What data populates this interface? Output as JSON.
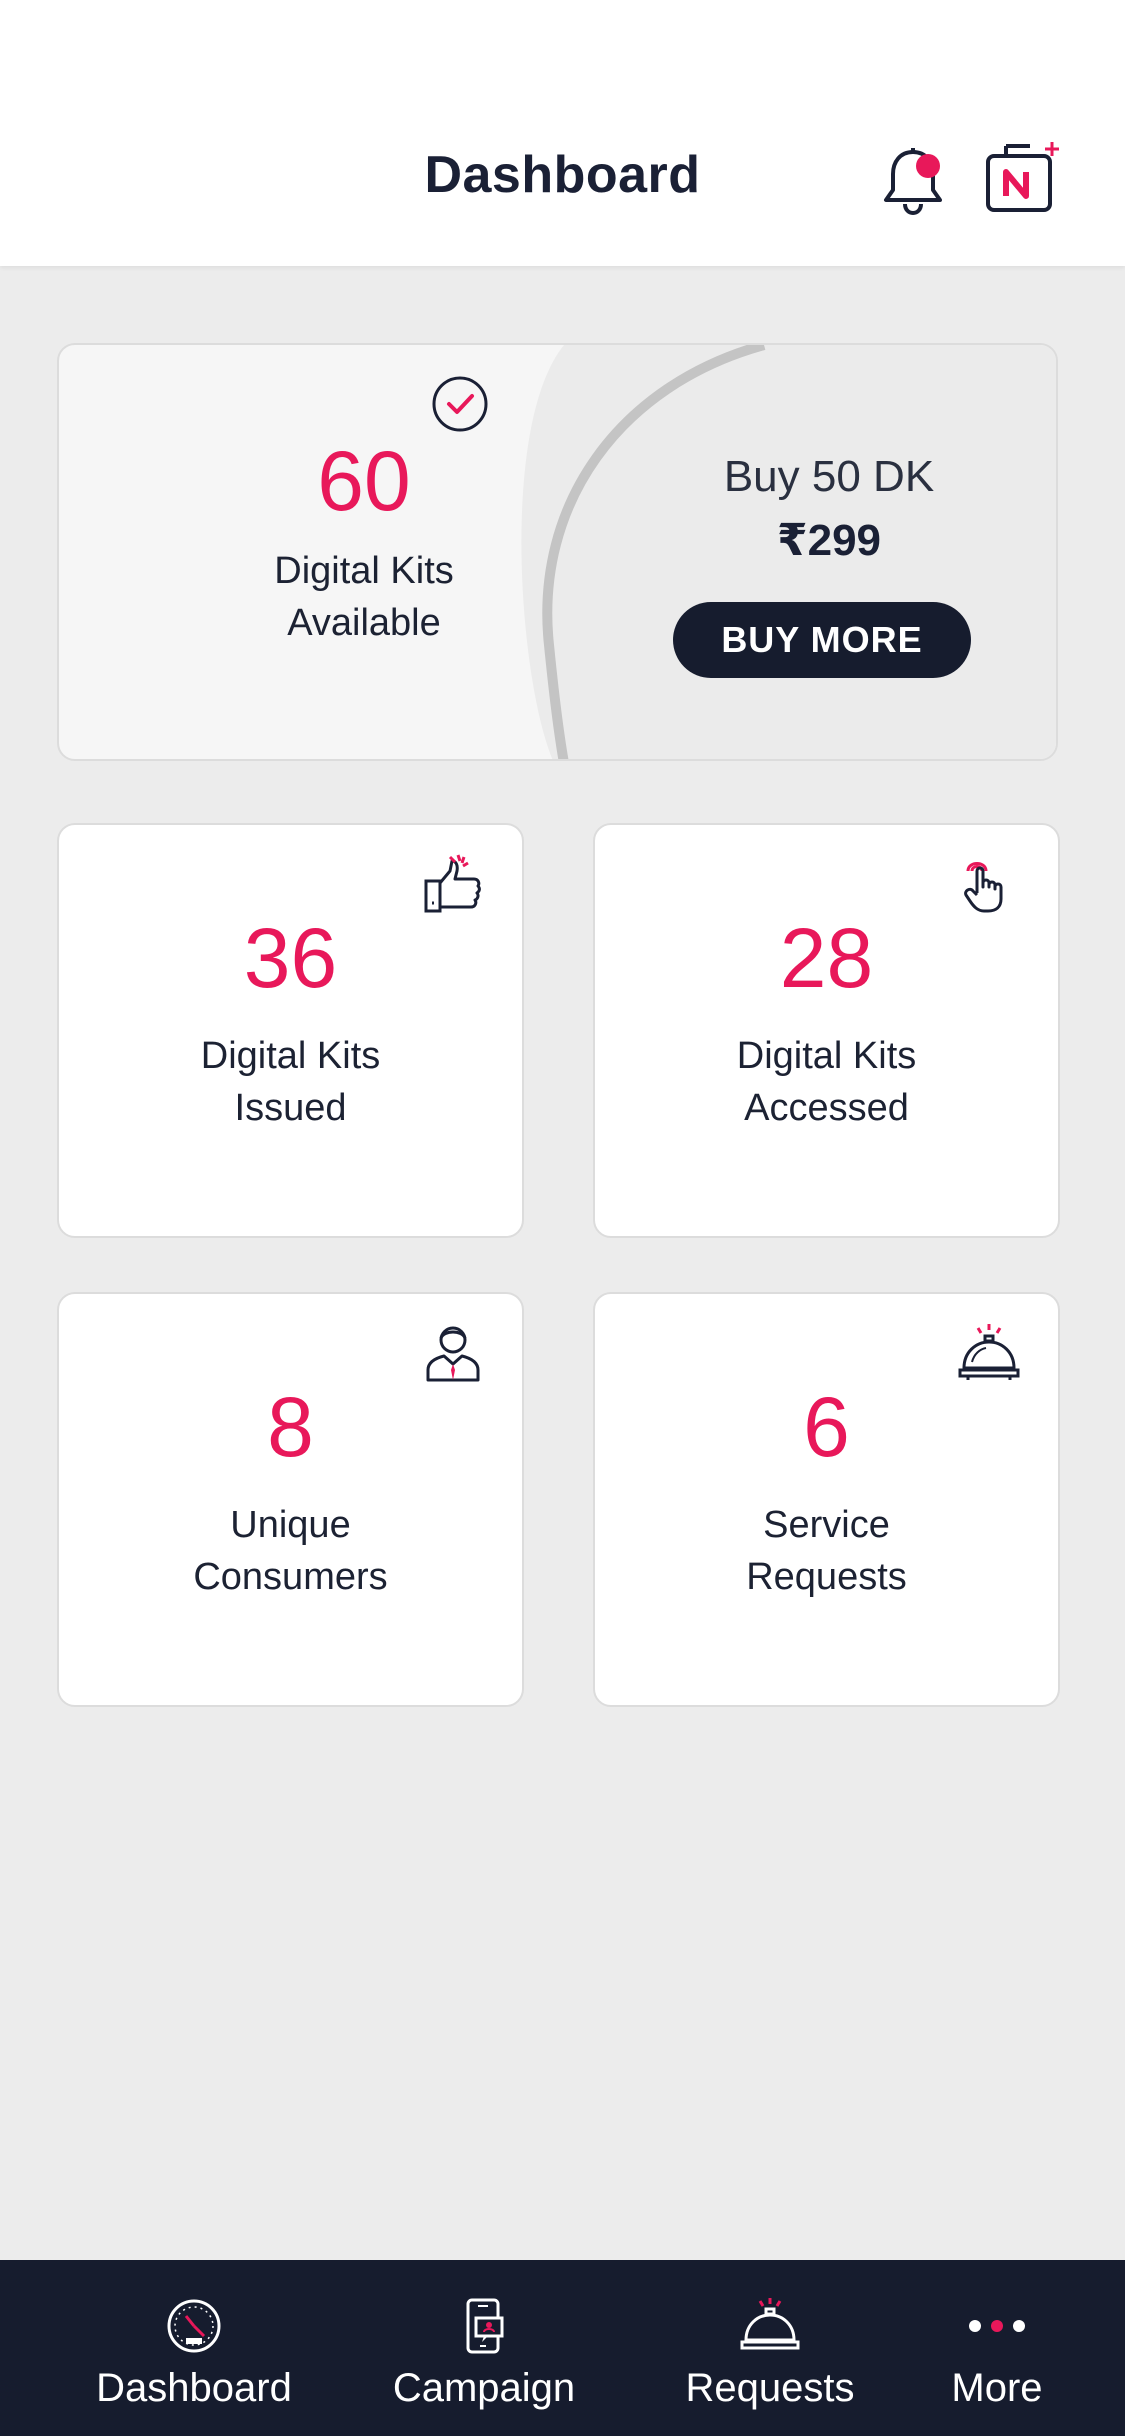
{
  "header": {
    "title": "Dashboard",
    "bell_icon": "bell-icon",
    "bag_icon": "brand-bag-add-icon"
  },
  "kits_card": {
    "count": "60",
    "label_line1": "Digital Kits",
    "label_line2": "Available",
    "offer_text": "Buy 50 DK",
    "price": "₹299",
    "button_label": "BUY MORE"
  },
  "stats": [
    {
      "value": "36",
      "label_line1": "Digital Kits",
      "label_line2": "Issued",
      "icon": "thumbs-up-icon"
    },
    {
      "value": "28",
      "label_line1": "Digital Kits",
      "label_line2": "Accessed",
      "icon": "tap-hand-icon"
    },
    {
      "value": "8",
      "label_line1": "Unique",
      "label_line2": "Consumers",
      "icon": "person-icon"
    },
    {
      "value": "6",
      "label_line1": "Service",
      "label_line2": "Requests",
      "icon": "service-bell-icon"
    }
  ],
  "nav": [
    {
      "label": "Dashboard",
      "icon": "speedometer-icon"
    },
    {
      "label": "Campaign",
      "icon": "phone-campaign-icon"
    },
    {
      "label": "Requests",
      "icon": "service-bell-icon"
    },
    {
      "label": "More",
      "icon": "more-dots-icon"
    }
  ],
  "colors": {
    "accent": "#e8185a",
    "navy": "#161c2e",
    "background": "#ececec"
  }
}
